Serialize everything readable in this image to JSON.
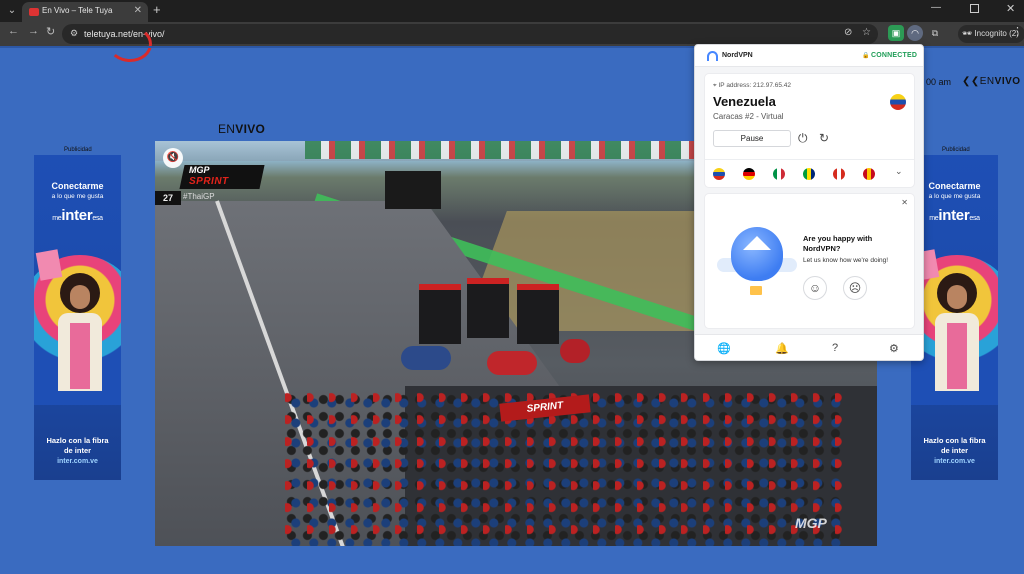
{
  "browser": {
    "tab_title": "En Vivo – Tele Tuya",
    "url": "teletuya.net/en-vivo/",
    "incognito_label": "Incognito (2)",
    "icons": [
      "tab-search-icon",
      "close-icon",
      "new-tab-icon",
      "back-icon",
      "forward-icon",
      "reload-icon",
      "site-info-icon",
      "eye-off-icon",
      "star-icon",
      "extension-icon",
      "nordvpn-extension-icon",
      "puzzle-icon",
      "incognito-icon",
      "kebab-icon"
    ]
  },
  "page": {
    "time_partial": "00 am",
    "header_logo": {
      "prefix": "EN",
      "bold": "VIVO"
    },
    "section_heading": {
      "prefix": "EN",
      "bold": "VIVO"
    },
    "ad_caption": "Publicidad",
    "ad": {
      "headline": "Conectarme",
      "subline": "a lo que me gusta",
      "brand_prefix": "me",
      "brand_main": "inter",
      "brand_suffix": "esa",
      "cta_line1": "Hazlo con la fibra",
      "cta_line2": "de inter",
      "cta_url": "inter.com.ve"
    },
    "video": {
      "overlay_brand": "MGP",
      "overlay_sprint": "SPRINT",
      "overlay_number": "27",
      "overlay_hashtag": "#ThaiGP",
      "board_text": "SPRINT",
      "watermark": "MGP"
    }
  },
  "nordvpn": {
    "brand": "NordVPN",
    "status": "CONNECTED",
    "ip_label": "IP address: 212.97.65.42",
    "country": "Venezuela",
    "server": "Caracas #2 - Virtual",
    "pause_label": "Pause",
    "quick_flags": [
      {
        "country": "Venezuela",
        "colors": [
          "#f7d117",
          "#1e4fae",
          "#d52b1e"
        ]
      },
      {
        "country": "Germany",
        "colors": [
          "#000000",
          "#dd0000",
          "#ffce00"
        ]
      },
      {
        "country": "Italy",
        "colors": [
          "#009246",
          "#ffffff",
          "#ce2b37"
        ]
      },
      {
        "country": "Brazil",
        "colors": [
          "#009c3b",
          "#ffdf00",
          "#002776"
        ]
      },
      {
        "country": "Canada",
        "colors": [
          "#d52b1e",
          "#ffffff",
          "#d52b1e"
        ]
      },
      {
        "country": "Spain",
        "colors": [
          "#c60b1e",
          "#ffc400",
          "#c60b1e"
        ]
      }
    ],
    "feedback_question": "Are you happy with NordVPN?",
    "feedback_sub": "Let us know how we're doing!",
    "accent": "#4687ff",
    "status_color": "#1f9d57"
  }
}
